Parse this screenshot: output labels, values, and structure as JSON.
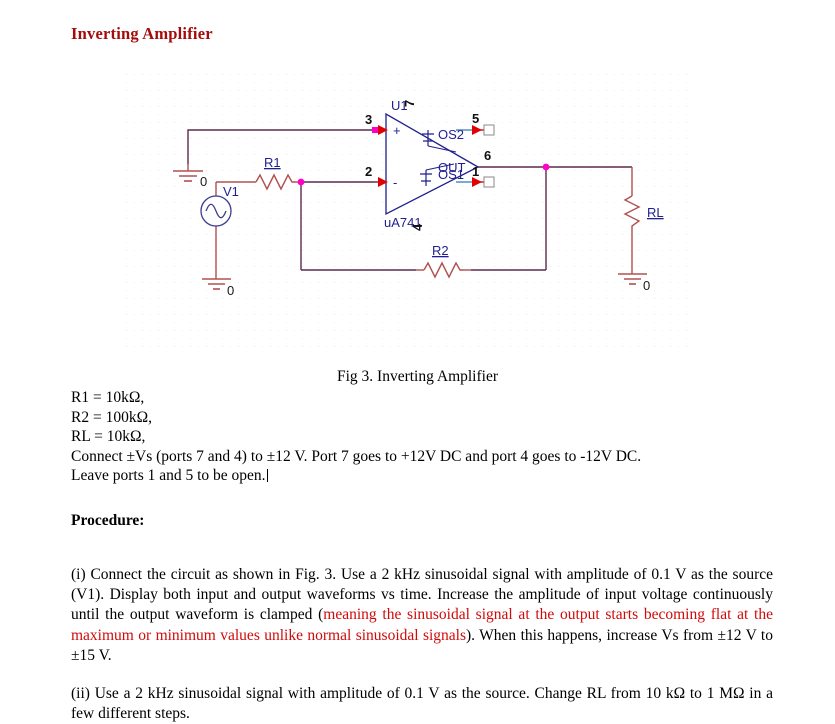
{
  "document": {
    "title": "Inverting Amplifier",
    "title_color": "#a50b0b"
  },
  "figure": {
    "caption": "Fig 3. Inverting Amplifier",
    "schematic": {
      "wire_color": "#5c2a4e",
      "component_color": "#b05050",
      "label_color": "#1f1f8f",
      "junction_color": "#ff00c8",
      "terminal_arrow_color": "#e00000",
      "grid_dot_color": "#e8e4ec",
      "labels": {
        "opamp_ref": "U1",
        "opamp_part": "uA741",
        "out_label": "OUT",
        "os2_label": "OS2",
        "os1_label": "OS1",
        "plus_label": "+",
        "minus_label": "-",
        "pin_3": "3",
        "pin_2": "2",
        "pin_7": "7",
        "pin_4": "4",
        "pin_5": "5",
        "pin_6": "6",
        "pin_1": "1",
        "r1": "R1",
        "r2": "R2",
        "rl": "RL",
        "source": "V1",
        "ground_left": "0",
        "ground_source": "0",
        "ground_load": "0"
      }
    }
  },
  "specs": [
    "R1 = 10kΩ,",
    "R2 = 100kΩ,",
    "RL = 10kΩ,",
    "Connect ±Vs (ports 7 and 4) to ±12 V. Port 7 goes to +12V DC and port 4 goes to -12V DC.",
    "Leave ports 1 and 5 to be open."
  ],
  "procedure": {
    "heading": "Procedure:",
    "item_i": {
      "text_before": "(i) Connect the circuit as shown in Fig. 3. Use a 2 kHz sinusoidal signal with amplitude of 0.1 V as the source (V1). Display both input and output waveforms vs time.  Increase the amplitude of input voltage continuously until the output waveform is clamped (",
      "text_red": "meaning the sinusoidal signal at the output starts becoming flat at the maximum or minimum values unlike normal sinusoidal signals",
      "text_after": "). When this happens, increase Vs from ±12 V to ±15 V."
    },
    "item_ii": {
      "text": "(ii) Use a 2 kHz sinusoidal signal with amplitude of 0.1 V as the source. Change RL from 10 kΩ to 1 MΩ in a few different steps."
    }
  }
}
